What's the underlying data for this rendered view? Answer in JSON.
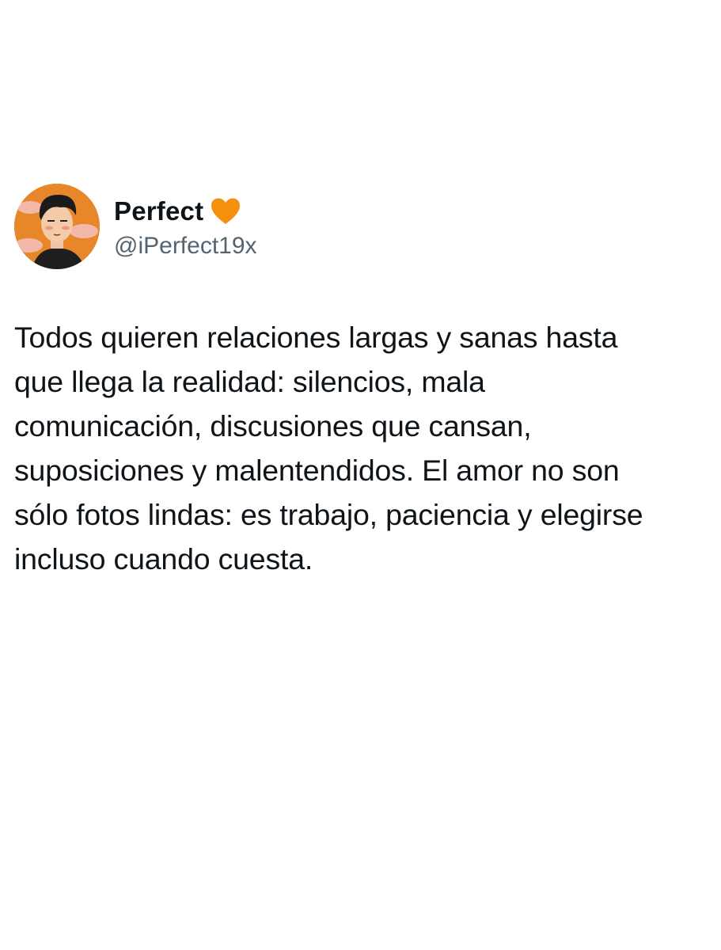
{
  "tweet": {
    "author": {
      "display_name": "Perfect",
      "handle": "@iPerfect19x",
      "badge_icon": "orange-heart-icon",
      "avatar_icon": "illustrated-man-avatar"
    },
    "text": "Todos quieren relaciones largas y sanas hasta\nque llega la realidad: silencios, mala\ncomunicación, discusiones que cansan,\nsuposiciones y malentendidos. El amor no son\nsólo fotos lindas: es trabajo, paciencia y elegirse\nincluso cuando cuesta."
  },
  "colors": {
    "background": "#ffffff",
    "text": "#0f1419",
    "handle": "#536471",
    "heart": "#f4900c",
    "avatar_bg": "#e8862a"
  }
}
